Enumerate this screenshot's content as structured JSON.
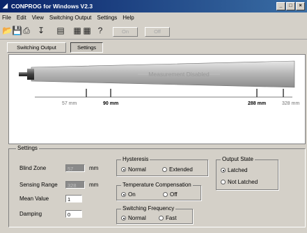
{
  "window": {
    "title": "CONPROG for Windows V2.3"
  },
  "menu": [
    "File",
    "Edit",
    "View",
    "Switching Output",
    "Settings",
    "Help"
  ],
  "toolbar": {
    "on_label": "On",
    "off_label": "Off"
  },
  "tabs": [
    "Switching Output",
    "Settings"
  ],
  "active_tab": "Settings",
  "graph": {
    "status": "Measurement Disabled",
    "ticks": [
      {
        "label": "57 mm",
        "bold": false
      },
      {
        "label": "90 mm",
        "bold": true
      },
      {
        "label": "288 mm",
        "bold": true
      },
      {
        "label": "328 mm",
        "bold": false
      }
    ]
  },
  "settings": {
    "title": "Settings",
    "blind_zone": {
      "label": "Blind Zone",
      "value": "57",
      "unit": "mm"
    },
    "sensing_range": {
      "label": "Sensing Range",
      "value": "328",
      "unit": "mm"
    },
    "mean_value": {
      "label": "Mean Value",
      "value": "1"
    },
    "damping": {
      "label": "Damping",
      "value": "0"
    }
  },
  "hysteresis": {
    "title": "Hysteresis",
    "options": [
      "Normal",
      "Extended"
    ],
    "selected": "Normal"
  },
  "temperature": {
    "title": "Temperature Compensation",
    "options": [
      "On",
      "Off"
    ],
    "selected": "On"
  },
  "frequency": {
    "title": "Switching Frequency",
    "options": [
      "Normal",
      "Fast"
    ],
    "selected": "Normal"
  },
  "output_state": {
    "title": "Output State",
    "options": [
      "Latched",
      "Not Latched"
    ],
    "selected": "Latched"
  }
}
